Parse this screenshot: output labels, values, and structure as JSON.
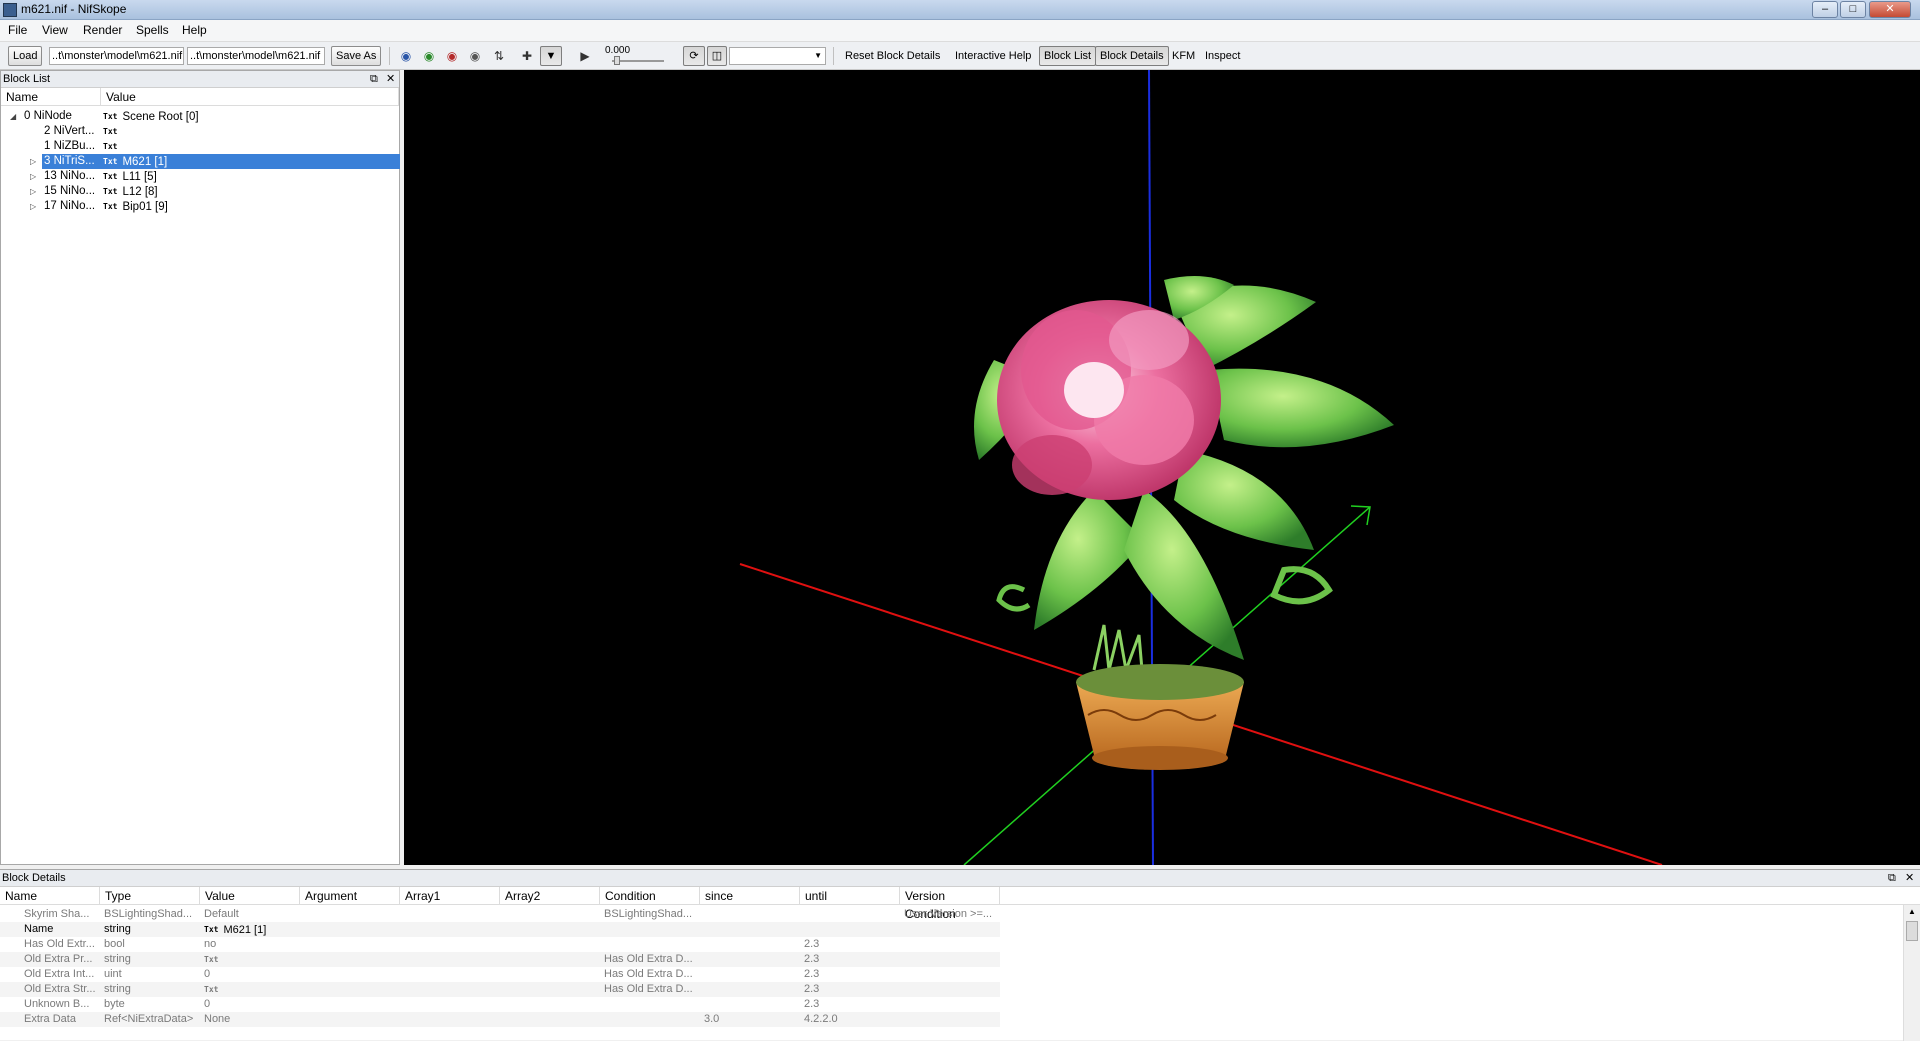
{
  "window": {
    "title": "m621.nif - NifSkope"
  },
  "menu": [
    "File",
    "View",
    "Render",
    "Spells",
    "Help"
  ],
  "toolbar": {
    "load": "Load",
    "load_path": "..t\\monster\\model\\m621.nif",
    "save_path": "..t\\monster\\model\\m621.nif",
    "save_as": "Save As",
    "time": "0.000",
    "reset_block_details": "Reset Block Details",
    "interactive_help": "Interactive Help",
    "block_list": "Block List",
    "block_details": "Block Details",
    "kfm": "KFM",
    "inspect": "Inspect"
  },
  "block_list": {
    "title": "Block List",
    "headers": [
      "Name",
      "Value"
    ],
    "rows": [
      {
        "expander": "◢",
        "name": "0 NiNode",
        "value": "Scene Root [0]",
        "selected": false
      },
      {
        "expander": "",
        "name": "2 NiVert...",
        "value": "",
        "selected": false
      },
      {
        "expander": "",
        "name": "1 NiZBu...",
        "value": "",
        "selected": false
      },
      {
        "expander": "▷",
        "name": "3 NiTriS...",
        "value": "M621 [1]",
        "selected": true
      },
      {
        "expander": "▷",
        "name": "13 NiNo...",
        "value": "L11 [5]",
        "selected": false
      },
      {
        "expander": "▷",
        "name": "15 NiNo...",
        "value": "L12 [8]",
        "selected": false
      },
      {
        "expander": "▷",
        "name": "17 NiNo...",
        "value": "Bip01 [9]",
        "selected": false
      }
    ],
    "txt_icon": "Txt"
  },
  "block_details": {
    "title": "Block Details",
    "headers": [
      "Name",
      "Type",
      "Value",
      "Argument",
      "Array1",
      "Array2",
      "Condition",
      "since",
      "until",
      "Version Condition"
    ],
    "rows": [
      {
        "name": "Skyrim Sha...",
        "type": "BSLightingShad...",
        "value": "Default",
        "cond": "BSLightingShad...",
        "since": "",
        "until": "",
        "vcond": "User Version >=...",
        "active": false,
        "txt": false
      },
      {
        "name": "Name",
        "type": "string",
        "value": "M621 [1]",
        "cond": "",
        "since": "",
        "until": "",
        "vcond": "",
        "active": true,
        "txt": true
      },
      {
        "name": "Has Old Extr...",
        "type": "bool",
        "value": "no",
        "cond": "",
        "since": "",
        "until": "2.3",
        "vcond": "",
        "active": false,
        "txt": false
      },
      {
        "name": "Old Extra Pr...",
        "type": "string",
        "value": "",
        "cond": "Has Old Extra D...",
        "since": "",
        "until": "2.3",
        "vcond": "",
        "active": false,
        "txt": true
      },
      {
        "name": "Old Extra Int...",
        "type": "uint",
        "value": "0",
        "cond": "Has Old Extra D...",
        "since": "",
        "until": "2.3",
        "vcond": "",
        "active": false,
        "txt": false
      },
      {
        "name": "Old Extra Str...",
        "type": "string",
        "value": "",
        "cond": "Has Old Extra D...",
        "since": "",
        "until": "2.3",
        "vcond": "",
        "active": false,
        "txt": true
      },
      {
        "name": "Unknown B...",
        "type": "byte",
        "value": "0",
        "cond": "",
        "since": "",
        "until": "2.3",
        "vcond": "",
        "active": false,
        "txt": false
      },
      {
        "name": "Extra Data",
        "type": "Ref<NiExtraData>",
        "value": "None",
        "cond": "",
        "since": "3.0",
        "until": "4.2.2.0",
        "vcond": "",
        "active": false,
        "txt": false
      }
    ]
  },
  "colors": {
    "selection": "#3a80d8",
    "viewport_bg": "#000000",
    "axis_x": "#e01010",
    "axis_y": "#20d020",
    "axis_z": "#1a2ee0"
  }
}
